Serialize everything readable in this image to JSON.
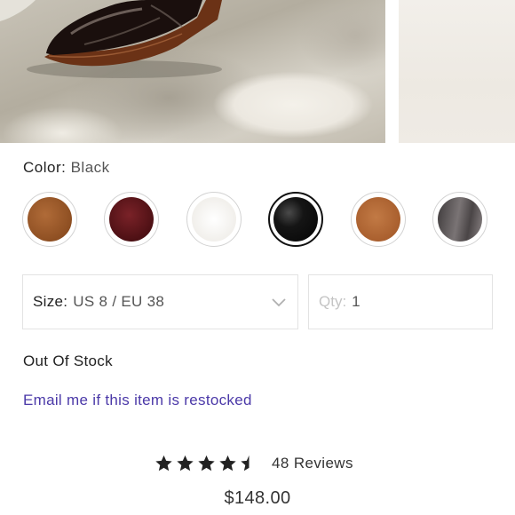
{
  "gallery": {
    "main_image": "product-photo-boot",
    "side_image": "product-photo-next"
  },
  "color": {
    "label": "Color:",
    "value": "Black",
    "swatches": [
      {
        "fill": "#9c5a2a",
        "selected": false
      },
      {
        "fill": "#5a1418",
        "selected": false
      },
      {
        "fill": "#f3f2ef",
        "selected": false
      },
      {
        "fill": "#121212",
        "selected": true
      },
      {
        "fill": "#b46a3a",
        "selected": false
      },
      {
        "fill": "#5f5a5a",
        "selected": false
      }
    ]
  },
  "size": {
    "label": "Size:",
    "value": "US 8 / EU 38",
    "icon": "chevron-down-icon"
  },
  "qty": {
    "label": "Qty:",
    "value": "1"
  },
  "stock": {
    "status": "Out Of Stock",
    "restock_link": "Email me if this item is restocked"
  },
  "rating": {
    "value": 4.5,
    "max": 5,
    "reviews": "48 Reviews",
    "star_color": "#222222"
  },
  "price": "$148.00",
  "colors": {
    "link": "#4b39a8",
    "border": "#e3e3e3"
  }
}
